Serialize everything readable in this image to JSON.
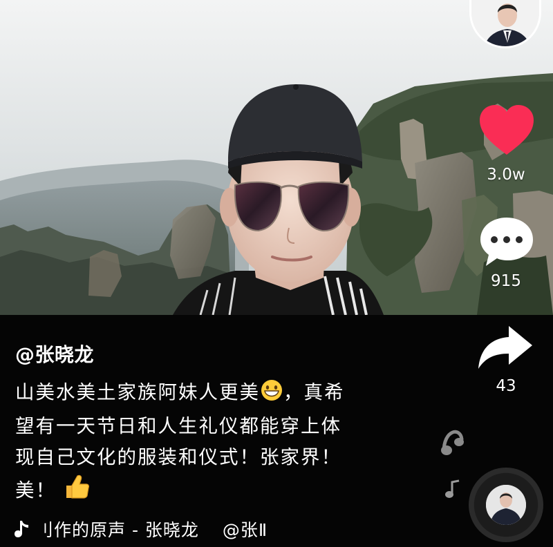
{
  "video": {
    "scene": "selfie-zhangjiajie-mountains"
  },
  "right_rail": {
    "likes": "3.0w",
    "comments": "915",
    "shares": "43",
    "like_color": "#fa2d55"
  },
  "post": {
    "author": "@张晓龙",
    "caption_line1": "山美水美土家族阿妹人更美",
    "caption_line1_tail": "，真希",
    "caption_line2": "望有一天节日和人生礼仪都能穿上体",
    "caption_line3": "现自己文化的服装和仪式！张家界！",
    "caption_line4": "美！"
  },
  "sound": {
    "text": "刂作的原声 - 张晓龙",
    "tail": "@张Ⅱ"
  },
  "icons": {
    "like": "heart-icon",
    "comment": "comment-bubble-icon",
    "share": "share-arrow-icon",
    "music": "music-note-icon",
    "emoji_smile": "grinning-emoji",
    "emoji_thumb": "thumbs-up-emoji"
  }
}
